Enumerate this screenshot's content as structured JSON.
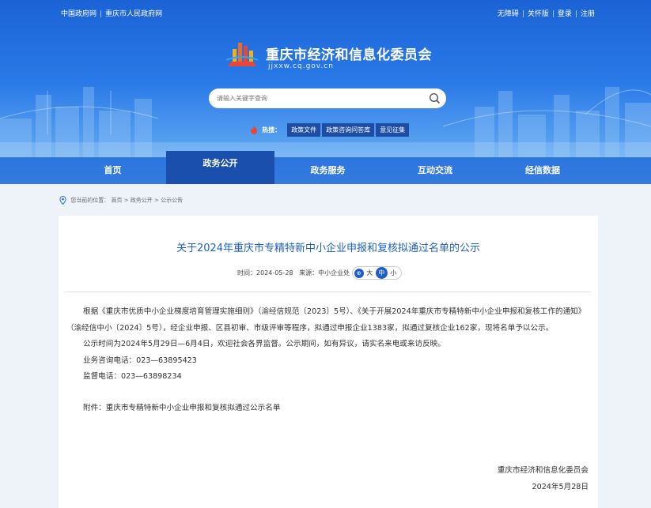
{
  "top_links": {
    "left": [
      "中国政府网",
      "重庆市人民政府网"
    ],
    "right": [
      "无障碍",
      "关怀版",
      "登录",
      "注册"
    ]
  },
  "site": {
    "title": "重庆市经济和信息化委员会",
    "domain": "jjxxw.cq.gov.cn"
  },
  "search": {
    "placeholder": "请输入关键字查询"
  },
  "hot": {
    "label": "热搜：",
    "tags": [
      "政策文件",
      "政策咨询问答库",
      "意见征集"
    ]
  },
  "nav": {
    "items": [
      "首页",
      "政务公开",
      "政务服务",
      "互动交流",
      "经信数据"
    ],
    "active_index": 1
  },
  "breadcrumb": {
    "prefix": "您当前的位置：",
    "items": [
      "首页",
      "政务公开",
      "公示公告"
    ],
    "separator": " > "
  },
  "article": {
    "title": "关于2024年重庆市专精特新中小企业申报和复核拟通过名单的公示",
    "time_label": "时间：",
    "time": "2024-05-28",
    "source_label": "来源：",
    "source": "中小企业处",
    "font_sizes": [
      "大",
      "中",
      "小"
    ],
    "font_size_active": "中",
    "para1": "根据《重庆市优质中小企业梯度培育管理实施细则》（渝经信规范〔2023〕5号）、《关于开展2024年重庆市专精特新中小企业申报和复核工作的通知》（渝经信中小〔2024〕5号），经企业申报、区县初审、市级评审等程序，拟通过申报企业1383家，拟通过复核企业162家，现将名单予以公示。",
    "para2": "公示时间为2024年5月29日—6月4日，欢迎社会各界监督。公示期间，如有异议，请实名来电或来访反映。",
    "para3": "业务咨询电话：023—63895423",
    "para4": "监督电话：023—63898234",
    "attachment_label": "附件：",
    "attachment": "重庆市专精特新中小企业申报和复核拟通过公示名单",
    "signature": "重庆市经济和信息化委员会",
    "date": "2024年5月28日"
  },
  "colors": {
    "banner_blue": "#2a7ae8",
    "nav_active": "#1a4fae",
    "title_blue": "#1d62c8",
    "tag_bg": "#1d4ea3"
  }
}
